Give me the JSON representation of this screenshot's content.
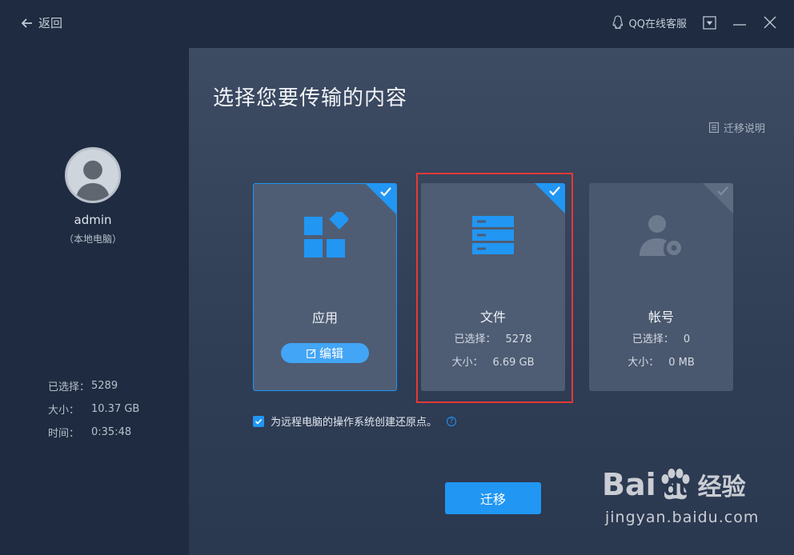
{
  "titlebar": {
    "back_label": "返回",
    "qq_service": "QQ在线客服"
  },
  "sidebar": {
    "username": "admin",
    "device": "（本地电脑）",
    "stats": [
      {
        "label": "已选择：",
        "value": "5289"
      },
      {
        "label": "大小：",
        "value": "10.37 GB"
      },
      {
        "label": "时间：",
        "value": "0:35:48"
      }
    ]
  },
  "main": {
    "title": "选择您要传输的内容",
    "guide_link": "迁移说明",
    "cards": [
      {
        "title": "应用",
        "edit_label": "编辑",
        "checked": true
      },
      {
        "title": "文件",
        "selected_label": "已选择：",
        "selected_value": "5278",
        "size_label": "大小：",
        "size_value": "6.69 GB",
        "checked": true
      },
      {
        "title": "帐号",
        "selected_label": "已选择：",
        "selected_value": "0",
        "size_label": "大小：",
        "size_value": "0 MB",
        "checked": false
      }
    ],
    "restore_point": {
      "label": "为远程电脑的操作系统创建还原点。",
      "checked": true,
      "help": "?"
    },
    "migrate_button": "迁移"
  },
  "watermark": {
    "brand_a": "Bai",
    "brand_b": "du",
    "brand_cn": "经验",
    "url": "jingyan.baidu.com"
  },
  "colors": {
    "accent": "#2196f3",
    "highlight": "#e53935",
    "sidebar_bg": "#1e2b40",
    "card_bg": "#4e5d74"
  }
}
